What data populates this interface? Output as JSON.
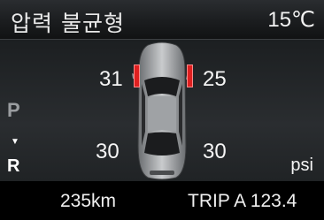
{
  "header": {
    "title": "압력 불균형",
    "temperature": "15℃"
  },
  "tires": {
    "front_left": "31",
    "front_right": "25",
    "rear_left": "30",
    "rear_right": "30",
    "warning_color": "#e02020",
    "warnings": [
      "front_left",
      "front_right"
    ]
  },
  "gear": {
    "park_label": "P",
    "arrow": "▼",
    "reverse_label": "R"
  },
  "unit": "psi",
  "footer": {
    "odometer": "235km",
    "trip": "TRIP A 123.4"
  },
  "icons": {
    "car": "car-top-view-icon"
  }
}
